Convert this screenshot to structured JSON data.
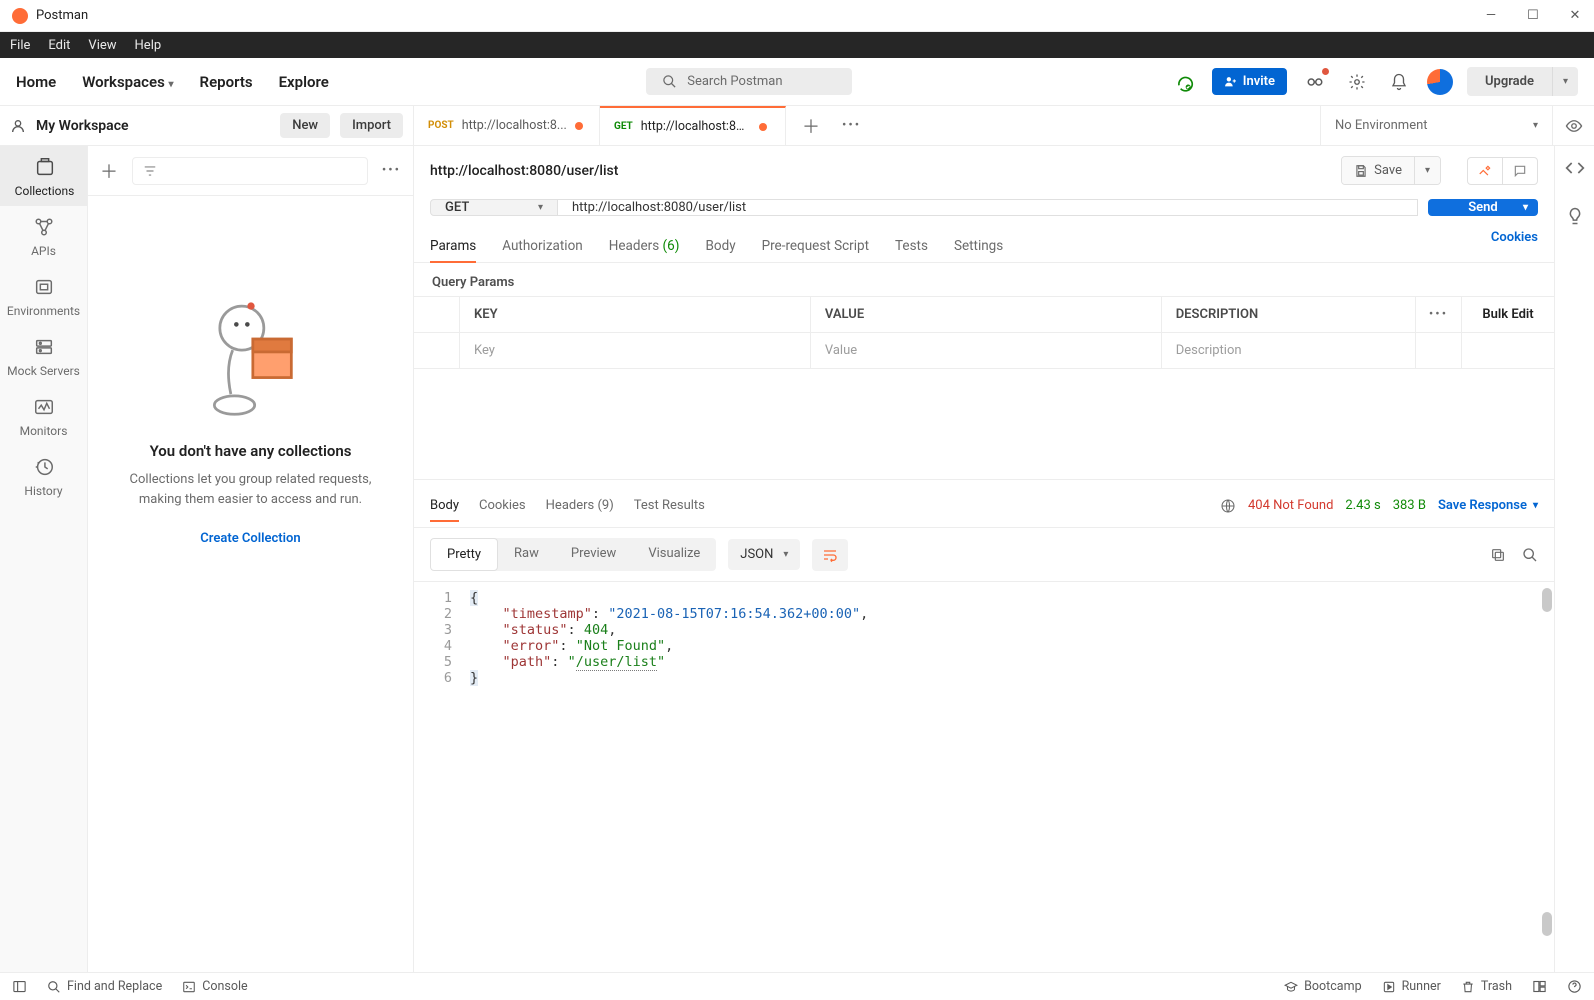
{
  "window": {
    "title": "Postman"
  },
  "menubar": [
    "File",
    "Edit",
    "View",
    "Help"
  ],
  "toolbar": {
    "nav": [
      "Home",
      "Workspaces",
      "Reports",
      "Explore"
    ],
    "search_placeholder": "Search Postman",
    "invite_label": "Invite",
    "upgrade_label": "Upgrade"
  },
  "workspace": {
    "name": "My Workspace",
    "new_label": "New",
    "import_label": "Import"
  },
  "rail": [
    {
      "id": "collections",
      "label": "Collections",
      "active": true
    },
    {
      "id": "apis",
      "label": "APIs"
    },
    {
      "id": "envs",
      "label": "Environments"
    },
    {
      "id": "mock",
      "label": "Mock Servers"
    },
    {
      "id": "monitors",
      "label": "Monitors"
    },
    {
      "id": "history",
      "label": "History"
    }
  ],
  "empty": {
    "title": "You don't have any collections",
    "subtitle": "Collections let you group related requests, making them easier to access and run.",
    "cta": "Create Collection"
  },
  "tabs": [
    {
      "method": "POST",
      "method_class": "post",
      "title": "http://localhost:8...",
      "dirty": true,
      "active": false
    },
    {
      "method": "GET",
      "method_class": "get",
      "title": "http://localhost:80...",
      "dirty": true,
      "active": true
    }
  ],
  "environment": {
    "selected": "No Environment"
  },
  "request": {
    "title": "http://localhost:8080/user/list",
    "save_label": "Save",
    "method": "GET",
    "url": "http://localhost:8080/user/list",
    "send_label": "Send",
    "tabs": {
      "params": "Params",
      "auth": "Authorization",
      "headers": "Headers",
      "headers_count": "(6)",
      "body": "Body",
      "pre": "Pre-request Script",
      "tests": "Tests",
      "settings": "Settings",
      "cookies": "Cookies"
    },
    "query_params": {
      "section": "Query Params",
      "columns": {
        "key": "KEY",
        "value": "VALUE",
        "desc": "DESCRIPTION"
      },
      "placeholders": {
        "key": "Key",
        "value": "Value",
        "desc": "Description"
      },
      "bulk_edit": "Bulk Edit"
    }
  },
  "response": {
    "tabs": {
      "body": "Body",
      "cookies": "Cookies",
      "headers": "Headers",
      "headers_count": "(9)",
      "tests": "Test Results"
    },
    "status": "404 Not Found",
    "time": "2.43 s",
    "size": "383 B",
    "save_label": "Save Response",
    "views": {
      "pretty": "Pretty",
      "raw": "Raw",
      "preview": "Preview",
      "visualize": "Visualize"
    },
    "type": "JSON",
    "body": {
      "timestamp": "2021-08-15T07:16:54.362+00:00",
      "status": 404,
      "error": "Not Found",
      "path": "/user/list"
    }
  },
  "statusbar": {
    "find": "Find and Replace",
    "console": "Console",
    "bootcamp": "Bootcamp",
    "runner": "Runner",
    "trash": "Trash"
  }
}
